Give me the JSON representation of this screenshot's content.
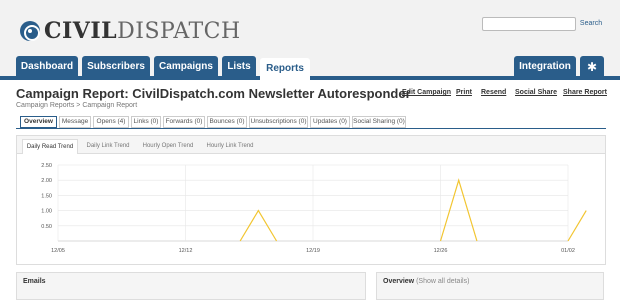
{
  "brand": {
    "civil": "CIVIL",
    "dispatch": "DISPATCH"
  },
  "search": {
    "value": "",
    "button": "Search"
  },
  "nav": {
    "tabs": [
      {
        "label": "Dashboard"
      },
      {
        "label": "Subscribers"
      },
      {
        "label": "Campaigns"
      },
      {
        "label": "Lists"
      },
      {
        "label": "Reports"
      }
    ],
    "integration": "Integration",
    "settings_icon": "gear-icon"
  },
  "report": {
    "title": "Campaign Report: CivilDispatch.com Newsletter Autoresponder",
    "breadcrumb": "Campaign Reports > Campaign Report",
    "actions": [
      "Edit Campaign",
      "Print",
      "Resend",
      "Social Share",
      "Share Report"
    ]
  },
  "subtabs": [
    "Overview",
    "Message",
    "Opens (4)",
    "Links (0)",
    "Forwards (0)",
    "Bounces (0)",
    "Unsubscriptions (0)",
    "Updates (0)",
    "Social Sharing (0)"
  ],
  "trend_tabs": [
    "Daily Read Trend",
    "Daily Link Trend",
    "Hourly Open Trend",
    "Hourly Link Trend"
  ],
  "chart_data": {
    "type": "line",
    "title": "",
    "xlabel": "",
    "ylabel": "",
    "x_tick_labels": [
      "12/05",
      "12/12",
      "12/19",
      "12/26",
      "01/02"
    ],
    "y_tick_labels": [
      "2.50",
      "2.00",
      "1.50",
      "1.00",
      "0.50",
      "0"
    ],
    "ylim": [
      0,
      2.5
    ],
    "grid": true,
    "series": [
      {
        "color": "#f2c530",
        "values": [
          {
            "x": "12/15",
            "y": 0
          },
          {
            "x": "12/16",
            "y": 1
          },
          {
            "x": "12/17",
            "y": 0
          },
          {
            "x": "12/26",
            "y": 0
          },
          {
            "x": "12/27",
            "y": 2
          },
          {
            "x": "12/28",
            "y": 0
          },
          {
            "x": "01/02",
            "y": 0
          },
          {
            "x": "01/03",
            "y": 1
          }
        ]
      }
    ]
  },
  "panels": {
    "emails": "Emails",
    "overview": "Overview",
    "overview_link": "(Show all details)"
  }
}
